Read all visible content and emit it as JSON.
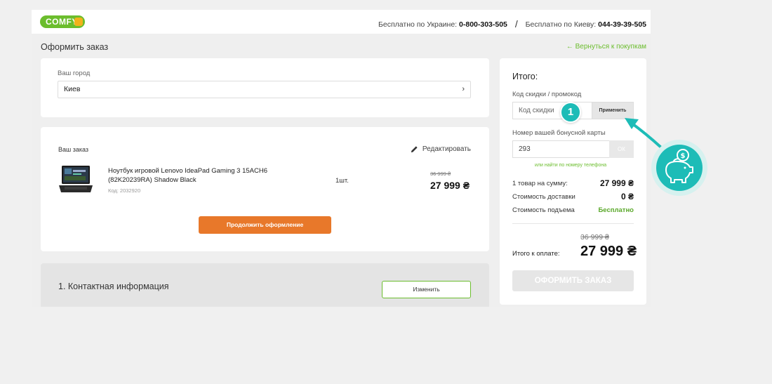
{
  "header": {
    "logo": "COMFY",
    "phone_ukraine_label": "Бесплатно по Украине:",
    "phone_ukraine": "0-800-303-505",
    "separator": "/",
    "phone_kyiv_label": "Бесплатно по Киеву:",
    "phone_kyiv": "044-39-39-505"
  },
  "page": {
    "title": "Оформить заказ",
    "back_link": "← Вернуться к покупкам"
  },
  "city": {
    "label": "Ваш город",
    "value": "Киев",
    "chevron": "›"
  },
  "order": {
    "label": "Ваш заказ",
    "edit": "Редактировать",
    "product": {
      "name": "Ноутбук игровой Lenovo IdeaPad Gaming 3 15ACH6 (82K20239RA) Shadow Black",
      "code": "Код: 2032920",
      "qty": "1шт.",
      "old_price": "36 999 ₴",
      "price": "27 999 ₴"
    },
    "continue": "Продолжить оформление"
  },
  "contact": {
    "title": "1. Контактная информация",
    "change": "Изменить"
  },
  "summary": {
    "title": "Итого:",
    "promo_label": "Код скидки / промокод",
    "promo_placeholder": "Код скидки",
    "promo_apply": "Применить",
    "bonus_label": "Номер вашей бонусной карты",
    "bonus_value": "293",
    "bonus_ok": "ОК",
    "phone_link": "или найти по номеру телефона",
    "rows": [
      {
        "label": "1 товар на сумму:",
        "value": "27 999 ₴"
      },
      {
        "label": "Стоимость доставки",
        "value": "0 ₴"
      },
      {
        "label": "Стоимость подъема",
        "value": "Бесплатно"
      }
    ],
    "total_old": "36 999 ₴",
    "total_label": "Итого к оплате:",
    "total_value": "27 999 ₴",
    "submit": "ОФОРМИТЬ ЗАКАЗ"
  },
  "annotation": {
    "step": "1"
  },
  "colors": {
    "brand_green": "#6bbd2d",
    "orange": "#e8782a",
    "teal": "#1dbcb7"
  }
}
